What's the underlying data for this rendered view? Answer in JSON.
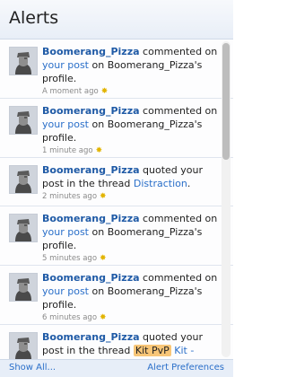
{
  "header": {
    "title": "Alerts"
  },
  "alerts": [
    {
      "user": "Boomerang_Pizza",
      "action": " commented on ",
      "link": "your post",
      "rest": " on Boomerang_Pizza's profile.",
      "time": "A moment ago"
    },
    {
      "user": "Boomerang_Pizza",
      "action": " commented on ",
      "link": "your post",
      "rest": " on Boomerang_Pizza's profile.",
      "time": "1 minute ago"
    },
    {
      "user": "Boomerang_Pizza",
      "action": " quoted your post in the thread ",
      "link": "Distraction",
      "rest": ".",
      "time": "2 minutes ago"
    },
    {
      "user": "Boomerang_Pizza",
      "action": " commented on ",
      "link": "your post",
      "rest": " on Boomerang_Pizza's profile.",
      "time": "5 minutes ago"
    },
    {
      "user": "Boomerang_Pizza",
      "action": " commented on ",
      "link": "your post",
      "rest": " on Boomerang_Pizza's profile.",
      "time": "6 minutes ago"
    },
    {
      "user": "Boomerang_Pizza",
      "action": " quoted your post in the thread ",
      "prefix": "Kit PvP",
      "link": "Kit - Deity.",
      "rest": ""
    }
  ],
  "footer": {
    "show_all": "Show All...",
    "preferences": "Alert Preferences"
  },
  "icons": {
    "avatar": "user-avatar-icon",
    "star": "star-icon"
  }
}
